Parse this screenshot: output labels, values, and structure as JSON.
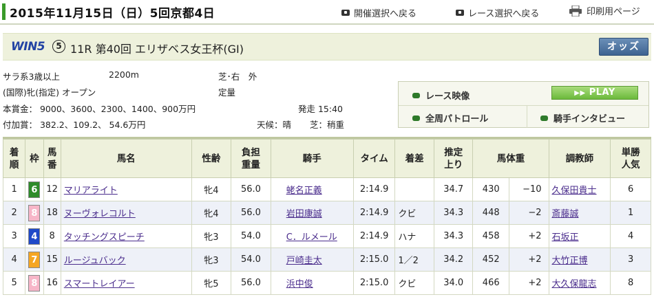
{
  "header": {
    "title": "2015年11月15日（日）5回京都4日",
    "nav_meeting": "開催選択へ戻る",
    "nav_race": "レース選択へ戻る",
    "nav_print": "印刷用ページ"
  },
  "race": {
    "win5_logo": "WIN5",
    "win5_number": "5",
    "name": "11R 第40回 エリザベス女王杯(GI)",
    "odds_label": "オッズ"
  },
  "conditions": {
    "class": "サラ系3歳以上",
    "distance": "2200m",
    "course": "芝･右　外",
    "restriction": "(国際)牝(指定) オープン",
    "weight_rule": "定量",
    "prize": "本賞金：  9000、3600、2300、1400、900万円",
    "start": "発走 15:40",
    "added_prize": "付加賞：  382.2、109.2、  54.6万円",
    "weather": "天候：晴",
    "track": "芝：稍重"
  },
  "media": {
    "video_label": "レース映像",
    "play_label": "PLAY",
    "patrol_label": "全周パトロール",
    "interview_label": "騎手インタビュー"
  },
  "table": {
    "headers": {
      "rank": "着順",
      "waku": "枠",
      "umaban": "馬番",
      "horse": "馬名",
      "sexage": "性齢",
      "weight": "負担重量",
      "jockey": "騎手",
      "time": "タイム",
      "margin": "着差",
      "last3f": "推定上り",
      "body": "馬体重",
      "trainer": "調教師",
      "pop": "単勝人気"
    },
    "rows": [
      {
        "rank": "1",
        "waku": "6",
        "umaban": "12",
        "horse": "マリアライト",
        "sexage": "牝4",
        "weight": "56.0",
        "jockey": "蛯名正義",
        "time": "2:14.9",
        "margin": "",
        "last3f": "34.7",
        "body": "430",
        "diff": "−10",
        "trainer": "久保田貴士",
        "pop": "6"
      },
      {
        "rank": "2",
        "waku": "8",
        "umaban": "18",
        "horse": "ヌーヴォレコルト",
        "sexage": "牝4",
        "weight": "56.0",
        "jockey": "岩田康誠",
        "time": "2:14.9",
        "margin": "クビ",
        "last3f": "34.3",
        "body": "448",
        "diff": "−2",
        "trainer": "斎藤誠",
        "pop": "1"
      },
      {
        "rank": "3",
        "waku": "4",
        "umaban": "8",
        "horse": "タッチングスピーチ",
        "sexage": "牝3",
        "weight": "54.0",
        "jockey": "C．ルメール",
        "time": "2:14.9",
        "margin": "ハナ",
        "last3f": "34.3",
        "body": "458",
        "diff": "+2",
        "trainer": "石坂正",
        "pop": "4"
      },
      {
        "rank": "4",
        "waku": "7",
        "umaban": "15",
        "horse": "ルージュバック",
        "sexage": "牝3",
        "weight": "54.0",
        "jockey": "戸崎圭太",
        "time": "2:15.0",
        "margin": "1／2",
        "last3f": "34.2",
        "body": "452",
        "diff": "+2",
        "trainer": "大竹正博",
        "pop": "3"
      },
      {
        "rank": "5",
        "waku": "8",
        "umaban": "16",
        "horse": "スマートレイアー",
        "sexage": "牝5",
        "weight": "56.0",
        "jockey": "浜中俊",
        "time": "2:15.0",
        "margin": "クビ",
        "last3f": "34.0",
        "body": "466",
        "diff": "+2",
        "trainer": "大久保龍志",
        "pop": "8"
      }
    ]
  },
  "waku_colors": {
    "4": {
      "bg": "#1f49c8",
      "fg": "#ffffff"
    },
    "6": {
      "bg": "#2e8b2a",
      "fg": "#ffffff"
    },
    "7": {
      "bg": "#f5a623",
      "fg": "#ffffff"
    },
    "8": {
      "bg": "#f7b6c8",
      "fg": "#ffffff"
    }
  }
}
